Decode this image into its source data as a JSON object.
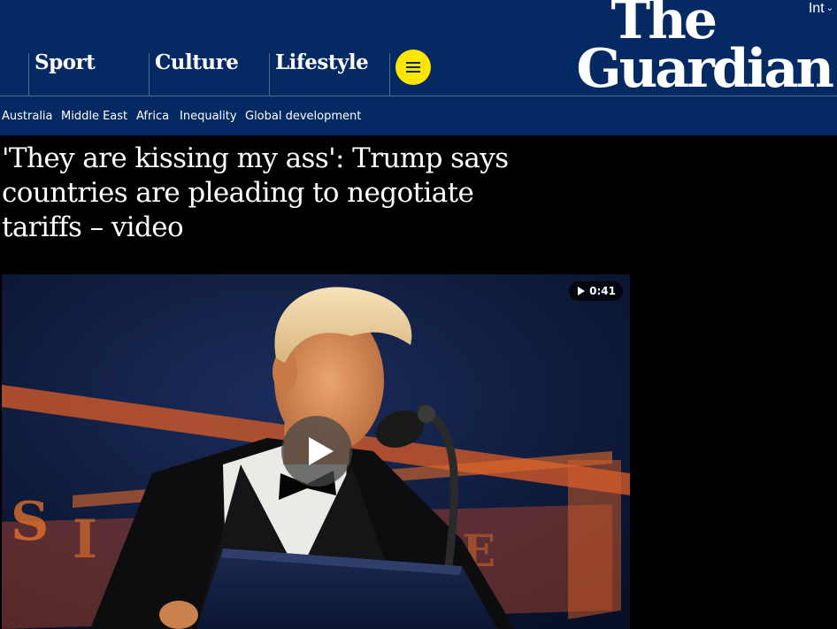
{
  "header": {
    "edition": "Int",
    "logo_line1": "The",
    "logo_line2": "Guardian",
    "pillars": [
      "Sport",
      "Culture",
      "Lifestyle"
    ],
    "menu_icon": "hamburger-icon",
    "colors": {
      "brand": "#052962",
      "menu_button": "#ffe500"
    }
  },
  "subnav": {
    "items": [
      "Australia",
      "Middle East",
      "Africa",
      "Inequality",
      "Global development"
    ]
  },
  "article": {
    "headline": "'They are kissing my ass': Trump says countries are pleading to negotiate tariffs – video"
  },
  "video": {
    "duration": "0:41",
    "play_icon": "play-icon"
  }
}
